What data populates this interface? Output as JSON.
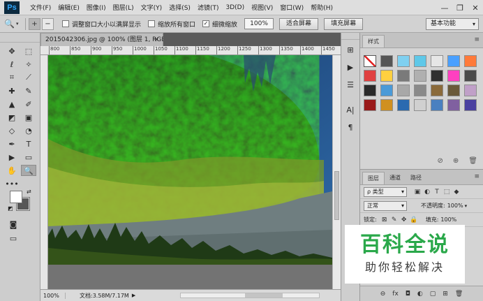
{
  "app": {
    "logo": "Ps"
  },
  "menu": [
    "文件(F)",
    "编辑(E)",
    "图像(I)",
    "图层(L)",
    "文字(Y)",
    "选择(S)",
    "滤镜(T)",
    "3D(D)",
    "视图(V)",
    "窗口(W)",
    "帮助(H)"
  ],
  "window_controls": {
    "minimize": "—",
    "restore": "❐",
    "close": "✕"
  },
  "options": {
    "tool_icon": "🔍",
    "zoom_in_icon": "+",
    "zoom_out_icon": "−",
    "check_resize": "调整窗口大小以满屏显示",
    "check_zoom_all": "缩放所有窗口",
    "check_scrubby": "细微缩放",
    "check_mark": "✓",
    "zoom_value": "100%",
    "fit_screen": "适合屏幕",
    "fill_screen": "填充屏幕",
    "workspace": "基本功能"
  },
  "document": {
    "tab_title": "2015042306.jpg @ 100% (图层 1, RGB/8#) *",
    "close": "×",
    "ruler_ticks": [
      "800",
      "850",
      "900",
      "950",
      "1000",
      "1050",
      "1100",
      "1150",
      "1200",
      "1250",
      "1300",
      "1350",
      "1400",
      "1450"
    ],
    "status_zoom": "100%",
    "status_doc": "文档:3.58M/7.17M",
    "status_arrow": "▶"
  },
  "tools": [
    "✥",
    "⬚",
    "ℓ",
    "✧",
    "⌗",
    "⟋",
    "✚",
    "✎",
    "▲",
    "✐",
    "◩",
    "▣",
    "◇",
    "◔",
    "✒",
    "T",
    "▶",
    "▭",
    "✋",
    "🔍",
    "•••"
  ],
  "colors": {
    "foreground": "#ffffff",
    "background": "#575757",
    "swap": "⇄",
    "default": "◩"
  },
  "dock_icons": [
    "⊞",
    "▶",
    "☰",
    "A|",
    "¶"
  ],
  "styles_panel": {
    "tab": "样式",
    "menu": "≡",
    "swatches": [
      "#ffffff",
      "#555555",
      "#7fd0f0",
      "#5fc8e8",
      "#e6e6e6",
      "#4aa0ff",
      "#ff7a3a",
      "#e04040",
      "#ffd040",
      "#7a7a7a",
      "#b0b0b0",
      "#303030",
      "#ff40c0",
      "#4a4a4a",
      "#2a2a2a",
      "#4a9ad8",
      "#a8a8a8",
      "#8a8a8a",
      "#8a6a3a",
      "#6a5a3a",
      "#c0a0c8",
      "#9a1a1a",
      "#d09020",
      "#2a6ab0",
      "#d0d0d0",
      "#4a80c0",
      "#8060a0",
      "#4a40a0"
    ],
    "foot_icons": [
      "⊘",
      "⊕",
      "🗑"
    ]
  },
  "layers_panel": {
    "tabs": [
      "图层",
      "通道",
      "路径"
    ],
    "menu": "≡",
    "kind_filter": "ρ 类型",
    "filter_icons": [
      "▣",
      "◐",
      "T",
      "⬚",
      "◆"
    ],
    "blend_mode": "正常",
    "opacity_label": "不透明度:",
    "opacity_value": "100%",
    "lock_label": "锁定:",
    "lock_icons": [
      "⊠",
      "✎",
      "✥",
      "🔒"
    ],
    "fill_label": "填充:",
    "fill_value": "100%",
    "foot_icons": [
      "⊖",
      "fx",
      "◘",
      "◐",
      "▢",
      "⊞",
      "🗑"
    ]
  },
  "watermark": {
    "title": "百科全说",
    "subtitle": "助你轻松解决"
  }
}
